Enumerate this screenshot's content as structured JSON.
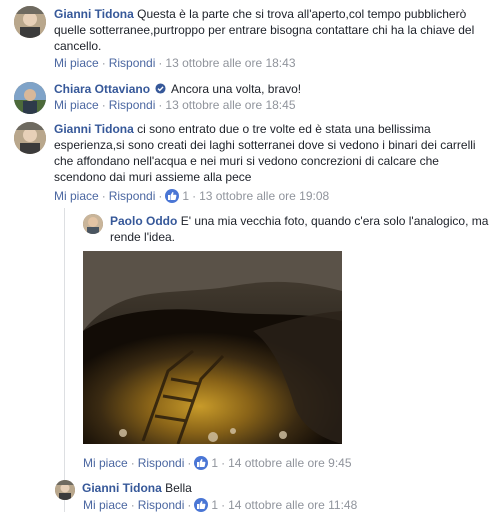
{
  "comments": [
    {
      "author": "Gianni Tidona",
      "text": "Questa è la parte che si trova all'aperto,col tempo pubblicherò quelle sotterranee,purtroppo per entrare bisogna contattare chi ha la chiave del cancello.",
      "like": "Mi piace",
      "reply": "Rispondi",
      "time": "13 ottobre alle ore 18:43"
    },
    {
      "author": "Chiara Ottaviano",
      "text": "Ancora una volta, bravo!",
      "like": "Mi piace",
      "reply": "Rispondi",
      "time": "13 ottobre alle ore 18:45"
    },
    {
      "author": "Gianni Tidona",
      "text": "ci sono entrato due o tre volte ed è stata una bellissima esperienza,si sono creati dei laghi sotterranei dove si vedono i binari dei carrelli che affondano nell'acqua e nei muri si vedono concrezioni di calcare che scendono dai muri assieme alla pece",
      "like": "Mi piace",
      "reply": "Rispondi",
      "likes": "1",
      "time": "13 ottobre alle ore 19:08"
    }
  ],
  "replies": [
    {
      "author": "Paolo Oddo",
      "text": "E' una mia vecchia foto, quando c'era solo l'analogico, ma rende l'idea.",
      "like": "Mi piace",
      "reply": "Rispondi",
      "likes": "1",
      "time": "14 ottobre alle ore 9:45"
    },
    {
      "author": "Gianni Tidona",
      "text": "Bella",
      "like": "Mi piace",
      "reply": "Rispondi",
      "likes": "1",
      "time": "14 ottobre alle ore 11:48"
    }
  ],
  "colors": {
    "name": "#365899",
    "link": "#4b67a1",
    "meta": "#90949c",
    "like_badge": "#4a76d5"
  },
  "icons": [
    "verified-badge-icon",
    "like-thumb-icon"
  ]
}
